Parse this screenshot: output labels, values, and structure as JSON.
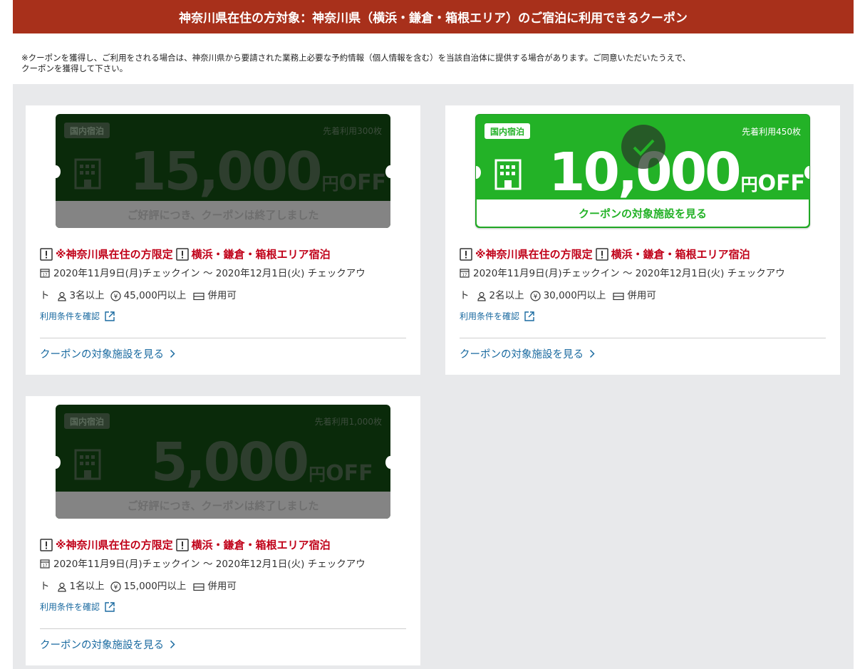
{
  "header": {
    "title": "神奈川県在住の方対象：神奈川県（横浜・鎌倉・箱根エリア）のご宿泊に利用できるクーポン"
  },
  "notice": {
    "line1": "※クーポンを獲得し、ご利用をされる場合は、神奈川県から要請された業務上必要な予約情報（個人情報を含む）を当該自治体に提供する場合があります。ご同意いただいたうえで、",
    "line2": "クーポンを獲得して下さい。"
  },
  "cards": [
    {
      "status": "ended",
      "tag": "国内宿泊",
      "limit": "先着利用300枚",
      "amount": "15,000",
      "yen": "円",
      "off": "OFF",
      "bottom": "ご好評につき、クーポンは終了しました",
      "tag1": "※神奈川県在住の方限定",
      "tag2": "横浜・鎌倉・箱根エリア宿泊",
      "dates1": "2020年11月9日(月)チェックイン 〜 2020年12月1日(火) チェックアウ",
      "dates2": "ト",
      "people": "3名以上",
      "price": "45,000円以上",
      "combine": "併用可",
      "terms": "利用条件を確認",
      "view": "クーポンの対象施設を見る"
    },
    {
      "status": "active",
      "tag": "国内宿泊",
      "limit": "先着利用450枚",
      "amount": "10,000",
      "yen": "円",
      "off": "OFF",
      "bottom": "クーポンの対象施設を見る",
      "tag1": "※神奈川県在住の方限定",
      "tag2": "横浜・鎌倉・箱根エリア宿泊",
      "dates1": "2020年11月9日(月)チェックイン 〜 2020年12月1日(火) チェックアウ",
      "dates2": "ト",
      "people": "2名以上",
      "price": "30,000円以上",
      "combine": "併用可",
      "terms": "利用条件を確認",
      "view": "クーポンの対象施設を見る"
    },
    {
      "status": "ended",
      "tag": "国内宿泊",
      "limit": "先着利用1,000枚",
      "amount": "5,000",
      "yen": "円",
      "off": "OFF",
      "bottom": "ご好評につき、クーポンは終了しました",
      "tag1": "※神奈川県在住の方限定",
      "tag2": "横浜・鎌倉・箱根エリア宿泊",
      "dates1": "2020年11月9日(月)チェックイン 〜 2020年12月1日(火) チェックアウ",
      "dates2": "ト",
      "people": "1名以上",
      "price": "15,000円以上",
      "combine": "併用可",
      "terms": "利用条件を確認",
      "view": "クーポンの対象施設を見る"
    }
  ],
  "colors": {
    "header_bg": "#a8301b",
    "active_green": "#23b227",
    "alert_red": "#c00018",
    "link_blue": "#1a6aa0",
    "page_gray": "#e8e9eb"
  }
}
